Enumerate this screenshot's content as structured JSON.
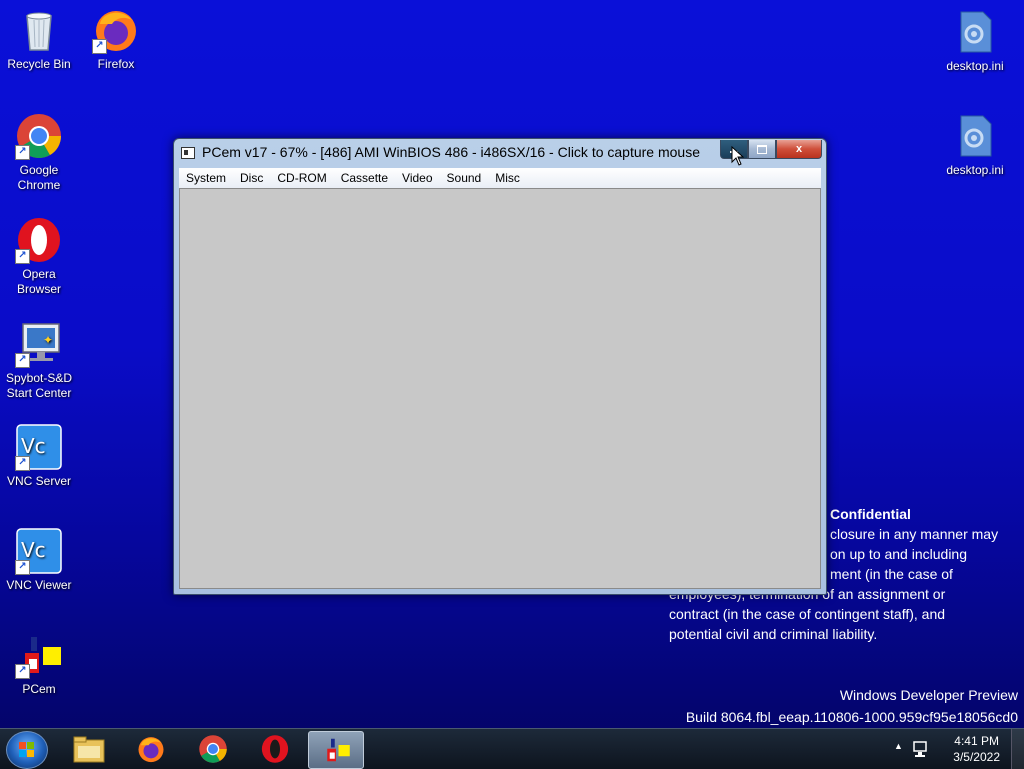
{
  "desktop": {
    "icons": [
      {
        "label": "Recycle Bin"
      },
      {
        "label": "Firefox"
      },
      {
        "label": "Google Chrome"
      },
      {
        "label": "Opera Browser"
      },
      {
        "label": "Spybot-S&D Start Center"
      },
      {
        "label": "VNC Server"
      },
      {
        "label": "VNC Viewer"
      },
      {
        "label": "PCem"
      },
      {
        "label": "desktop.ini"
      },
      {
        "label": "desktop.ini"
      }
    ]
  },
  "window": {
    "title": "PCem v17 - 67% - [486] AMI WinBIOS 486 - i486SX/16 - Click to capture mouse",
    "menu": [
      "System",
      "Disc",
      "CD-ROM",
      "Cassette",
      "Video",
      "Sound",
      "Misc"
    ],
    "close_glyph": "x"
  },
  "overlay": {
    "heading": "Confidential",
    "lines": [
      "closure in any manner may",
      "on up to and including",
      "ment (in the case of",
      "employees), termination of an assignment or",
      "contract (in the case of contingent staff), and",
      "potential civil and criminal liability."
    ]
  },
  "watermark": {
    "line1": "Windows Developer Preview",
    "line2": "Build 8064.fbl_eeap.110806-1000.959cf95e18056cd0"
  },
  "taskbar": {
    "time": "4:41 PM",
    "date": "3/5/2022"
  },
  "colors": {
    "desktop": "#0a10d8",
    "titlebar": "#b9cfe8",
    "client": "#c8c8c8",
    "close": "#cf4f3a"
  }
}
